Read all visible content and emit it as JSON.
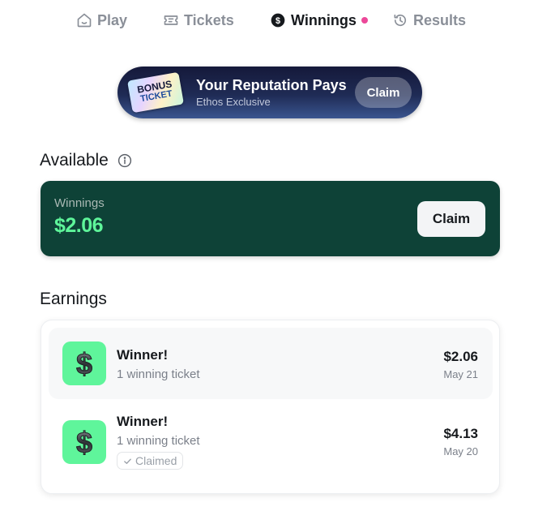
{
  "nav": {
    "items": [
      {
        "label": "Play",
        "icon": "home-icon"
      },
      {
        "label": "Tickets",
        "icon": "ticket-icon"
      },
      {
        "label": "Winnings",
        "icon": "dollar-circle-icon",
        "active": true
      },
      {
        "label": "Results",
        "icon": "history-icon"
      }
    ]
  },
  "promo": {
    "ticket_line1": "BONUS",
    "ticket_line2": "TICKET",
    "title": "Your Reputation Pays",
    "subtitle": "Ethos Exclusive",
    "claim_label": "Claim"
  },
  "available": {
    "section_title": "Available",
    "label": "Winnings",
    "amount": "$2.06",
    "claim_label": "Claim"
  },
  "earnings": {
    "section_title": "Earnings",
    "items": [
      {
        "title": "Winner!",
        "subtitle": "1 winning ticket",
        "amount": "$2.06",
        "date": "May 21"
      },
      {
        "title": "Winner!",
        "subtitle": "1 winning ticket",
        "amount": "$4.13",
        "date": "May 20",
        "status": "Claimed"
      }
    ]
  },
  "colors": {
    "accent_green": "#5ef59a",
    "card_dark_green": "#0e4237",
    "notification_dot": "#ec4899"
  }
}
